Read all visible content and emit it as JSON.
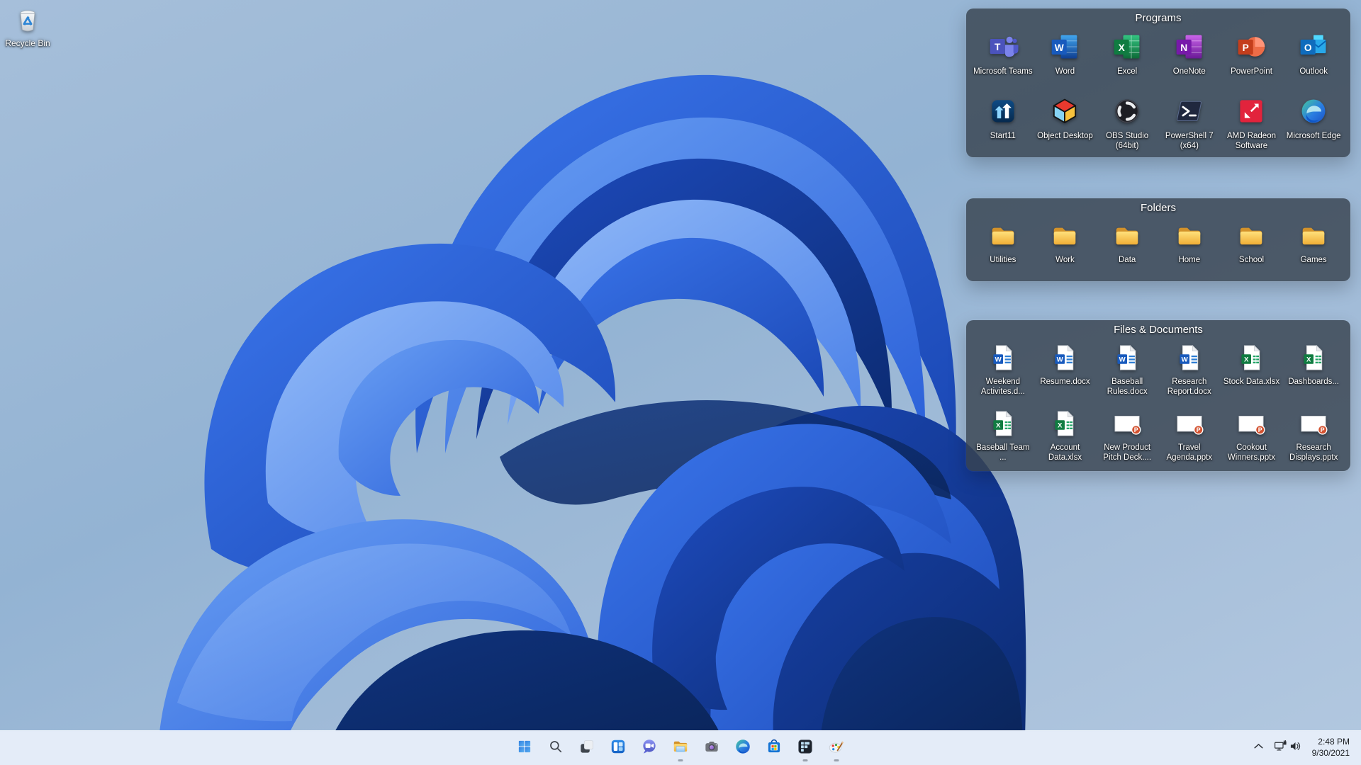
{
  "wallpaper": {
    "name": "windows-11-bloom",
    "base_top": "#a6bfda",
    "base_bottom": "#b2c8e0",
    "bloom_blues": [
      "#6aa0f4",
      "#2a5fd8",
      "#1a47b4",
      "#0b2a70"
    ]
  },
  "desktop": {
    "recycle_bin": {
      "label": "Recycle Bin",
      "icon": "recycle-bin"
    },
    "fences": [
      {
        "title": "Programs",
        "items": [
          {
            "label": "Microsoft Teams",
            "icon": "teams"
          },
          {
            "label": "Word",
            "icon": "word-app"
          },
          {
            "label": "Excel",
            "icon": "excel-app"
          },
          {
            "label": "OneNote",
            "icon": "onenote-app"
          },
          {
            "label": "PowerPoint",
            "icon": "powerpoint-app"
          },
          {
            "label": "Outlook",
            "icon": "outlook-app"
          },
          {
            "label": "Start11",
            "icon": "start11"
          },
          {
            "label": "Object Desktop",
            "icon": "object-desktop"
          },
          {
            "label": "OBS Studio (64bit)",
            "icon": "obs-studio"
          },
          {
            "label": "PowerShell 7 (x64)",
            "icon": "powershell"
          },
          {
            "label": "AMD Radeon Software",
            "icon": "amd-radeon"
          },
          {
            "label": "Microsoft Edge",
            "icon": "edge"
          }
        ]
      },
      {
        "title": "Folders",
        "items": [
          {
            "label": "Utilities",
            "icon": "folder"
          },
          {
            "label": "Work",
            "icon": "folder"
          },
          {
            "label": "Data",
            "icon": "folder"
          },
          {
            "label": "Home",
            "icon": "folder"
          },
          {
            "label": "School",
            "icon": "folder"
          },
          {
            "label": "Games",
            "icon": "folder"
          }
        ]
      },
      {
        "title": "Files & Documents",
        "items": [
          {
            "label": "Weekend Activites.d...",
            "icon": "word-doc"
          },
          {
            "label": "Resume.docx",
            "icon": "word-doc"
          },
          {
            "label": "Baseball Rules.docx",
            "icon": "word-doc"
          },
          {
            "label": "Research Report.docx",
            "icon": "word-doc"
          },
          {
            "label": "Stock Data.xlsx",
            "icon": "excel-doc"
          },
          {
            "label": "Dashboards...",
            "icon": "excel-doc"
          },
          {
            "label": "Baseball Team ...",
            "icon": "excel-doc"
          },
          {
            "label": "Account Data.xlsx",
            "icon": "excel-doc"
          },
          {
            "label": "New Product Pitch Deck....",
            "icon": "ppt-slide"
          },
          {
            "label": "Travel Agenda.pptx",
            "icon": "ppt-slide"
          },
          {
            "label": "Cookout Winners.pptx",
            "icon": "ppt-slide"
          },
          {
            "label": "Research Displays.pptx",
            "icon": "ppt-slide"
          }
        ]
      }
    ]
  },
  "taskbar": {
    "background": "#e4ecf8",
    "buttons": [
      {
        "name": "start",
        "icon": "start",
        "running": false
      },
      {
        "name": "search",
        "icon": "search",
        "running": false
      },
      {
        "name": "task-view",
        "icon": "task-view",
        "running": false
      },
      {
        "name": "widgets",
        "icon": "widgets",
        "running": false
      },
      {
        "name": "chat",
        "icon": "chat",
        "running": false
      },
      {
        "name": "file-explorer",
        "icon": "explorer",
        "running": true
      },
      {
        "name": "camera",
        "icon": "camera",
        "running": false
      },
      {
        "name": "edge-browser",
        "icon": "edge",
        "running": false
      },
      {
        "name": "microsoft-store",
        "icon": "store",
        "running": false
      },
      {
        "name": "fences",
        "icon": "fences-app",
        "running": true
      },
      {
        "name": "paint-palette",
        "icon": "palette",
        "running": true
      }
    ],
    "tray": {
      "chevron_icon": "chevron-up",
      "network_icon": "network",
      "volume_icon": "volume",
      "time": "2:48 PM",
      "date": "9/30/2021"
    }
  }
}
